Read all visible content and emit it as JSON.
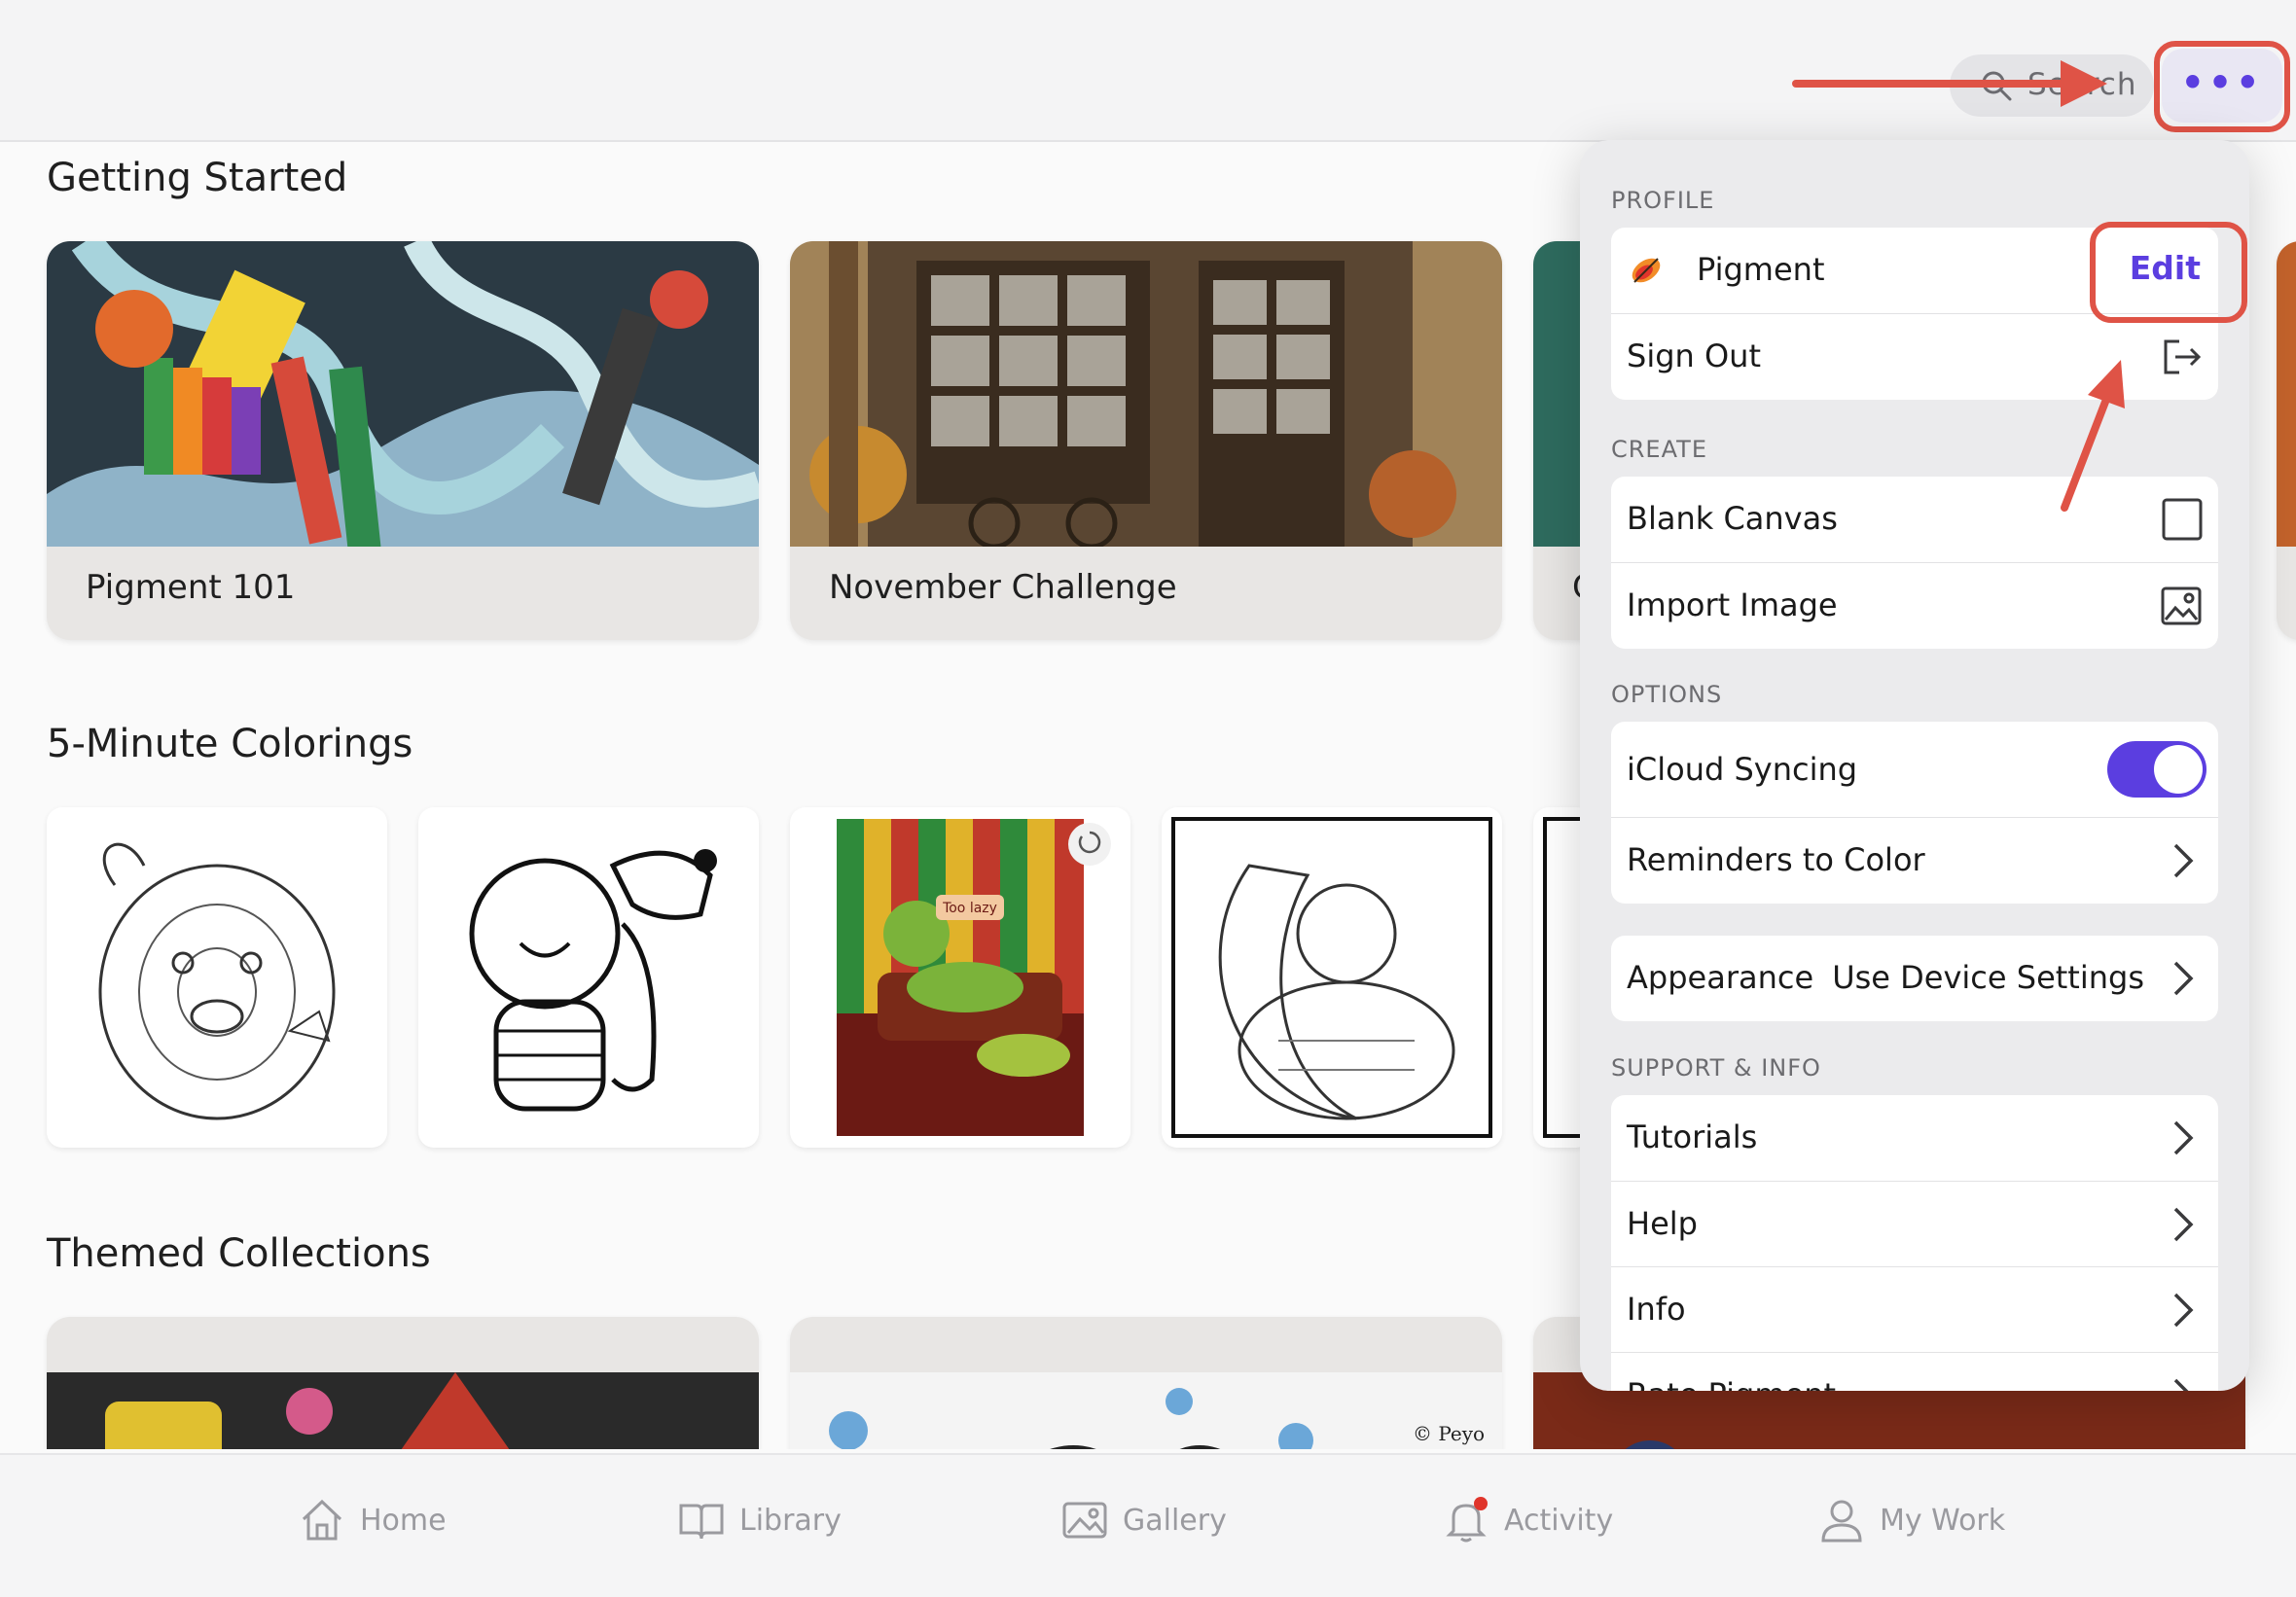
{
  "header": {
    "search_label": "Search",
    "more_label": "•••"
  },
  "sections": {
    "getting_started": "Getting Started",
    "five_minute": "5-Minute Colorings",
    "themed": "Themed Collections"
  },
  "getting_started_cards": [
    {
      "caption": "Pigment 101"
    },
    {
      "caption": "November Challenge"
    },
    {
      "caption": "C"
    }
  ],
  "menu": {
    "profile_header": "PROFILE",
    "profile_name": "Pigment",
    "edit_label": "Edit",
    "sign_out": "Sign Out",
    "create_header": "CREATE",
    "blank_canvas": "Blank Canvas",
    "import_image": "Import Image",
    "options_header": "OPTIONS",
    "icloud_syncing": "iCloud Syncing",
    "icloud_on": true,
    "reminders": "Reminders to Color",
    "appearance": "Appearance",
    "appearance_value": "Use Device Settings",
    "support_header": "SUPPORT & INFO",
    "tutorials": "Tutorials",
    "help": "Help",
    "info": "Info",
    "rate": "Rate Pigment"
  },
  "tabs": [
    {
      "label": "Home"
    },
    {
      "label": "Library"
    },
    {
      "label": "Gallery"
    },
    {
      "label": "Activity"
    },
    {
      "label": "My Work"
    }
  ],
  "colors": {
    "accent": "#5b3ee0",
    "highlight": "#df5346"
  },
  "tile_text": {
    "too_lazy": "Too lazy",
    "signature": "© Peyo"
  }
}
